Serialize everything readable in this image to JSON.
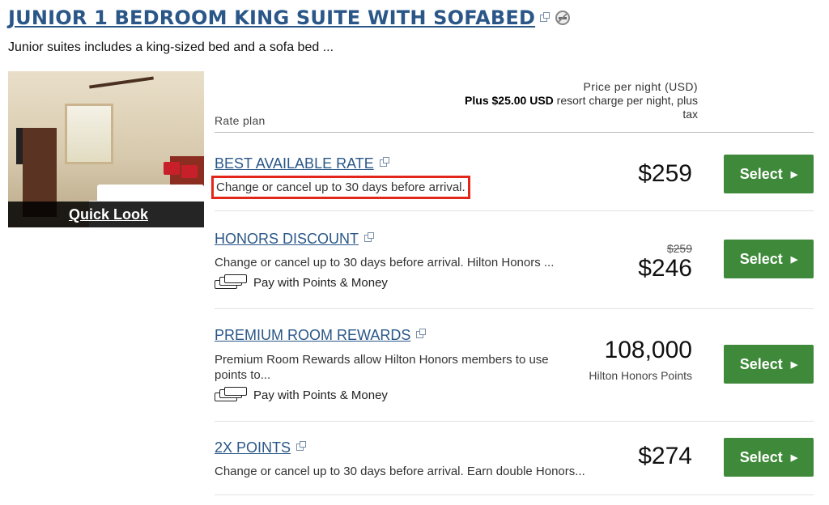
{
  "room": {
    "title": "JUNIOR 1 BEDROOM KING SUITE WITH SOFABED",
    "description": "Junior suites includes a king-sized bed and a sofa bed ...",
    "quick_look": "Quick Look"
  },
  "table_header": {
    "rate_plan": "Rate plan",
    "price_per_night": "Price per night (USD)",
    "resort_charge_bold": "Plus $25.00 USD",
    "resort_charge_rest": " resort charge per night, plus",
    "resort_charge_tax": "tax"
  },
  "rates": [
    {
      "name": "BEST AVAILABLE RATE",
      "description": "Change or cancel up to 30 days before arrival.",
      "price": "$259",
      "button": "Select"
    },
    {
      "name": "HONORS DISCOUNT",
      "description": "Change or cancel up to 30 days before arrival. Hilton Honors ...",
      "pay_option": "Pay with Points & Money",
      "original_price": "$259",
      "price": "$246",
      "button": "Select"
    },
    {
      "name": "PREMIUM ROOM REWARDS",
      "description": "Premium Room Rewards allow Hilton Honors members to use points to...",
      "pay_option": "Pay with Points & Money",
      "price": "108,000",
      "price_unit": "Hilton Honors Points",
      "button": "Select"
    },
    {
      "name": "2X POINTS",
      "description": "Change or cancel up to 30 days before arrival. Earn double Honors...",
      "price": "$274",
      "button": "Select"
    }
  ],
  "colors": {
    "link": "#2a5788",
    "select_button": "#3f8a3a",
    "highlight_border": "#e4261a"
  },
  "icons": [
    "external-link-icon",
    "no-smoking-icon",
    "cash-stack-icon",
    "chevron-right-icon"
  ]
}
